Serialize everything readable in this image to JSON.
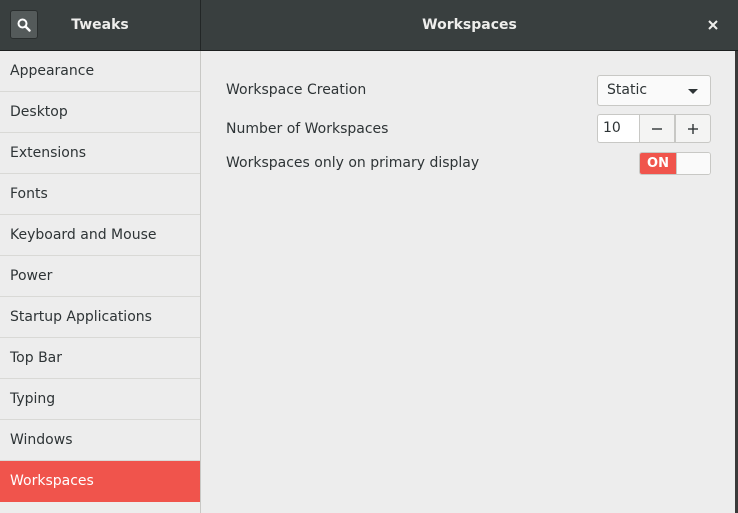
{
  "header": {
    "app_title": "Tweaks",
    "page_title": "Workspaces"
  },
  "sidebar": {
    "items": [
      {
        "label": "Appearance"
      },
      {
        "label": "Desktop"
      },
      {
        "label": "Extensions"
      },
      {
        "label": "Fonts"
      },
      {
        "label": "Keyboard and Mouse"
      },
      {
        "label": "Power"
      },
      {
        "label": "Startup Applications"
      },
      {
        "label": "Top Bar"
      },
      {
        "label": "Typing"
      },
      {
        "label": "Windows"
      },
      {
        "label": "Workspaces"
      }
    ],
    "selected": "Workspaces"
  },
  "settings": {
    "creation": {
      "label": "Workspace Creation",
      "value": "Static"
    },
    "count": {
      "label": "Number of Workspaces",
      "value": "10"
    },
    "primary_display": {
      "label": "Workspaces only on primary display",
      "state": "ON"
    }
  },
  "colors": {
    "accent": "#f0544c",
    "headerbar": "#393f3f",
    "background": "#ededed"
  },
  "icons": [
    "search-icon",
    "close-icon",
    "dropdown-arrow-icon",
    "minus-icon",
    "plus-icon"
  ]
}
